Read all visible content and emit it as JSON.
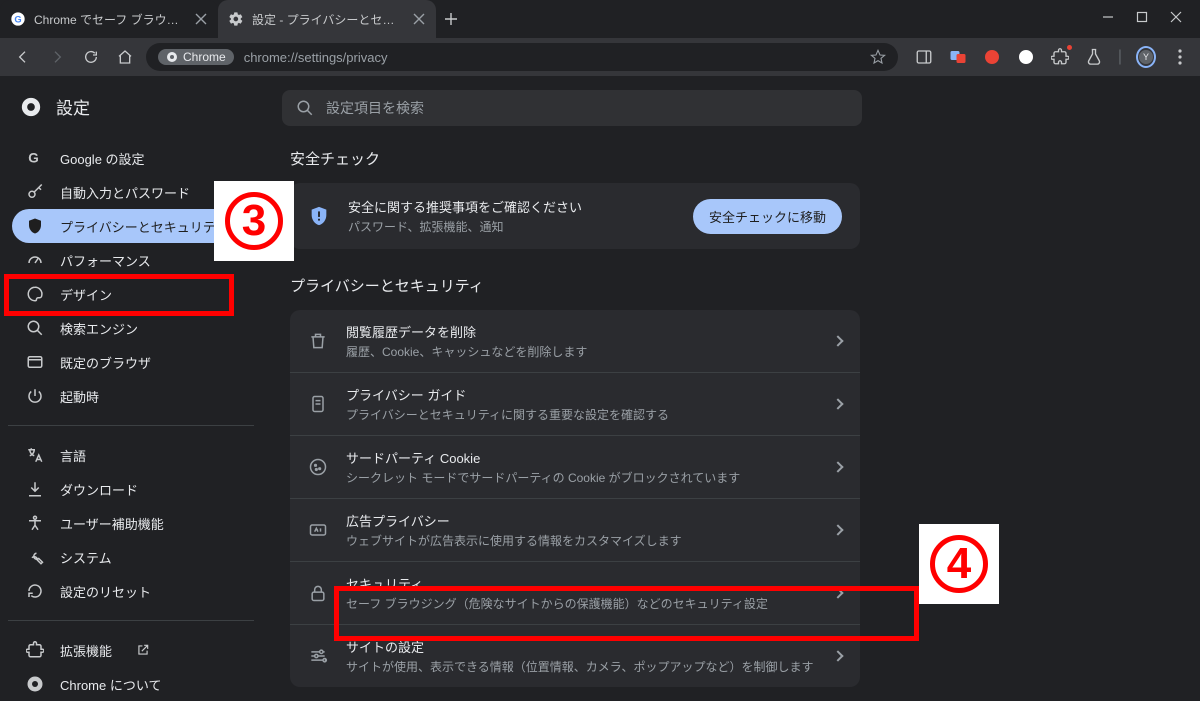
{
  "tabs": [
    {
      "title": "Chrome でセーフ ブラウジングの保…",
      "active": false,
      "favicon": "google-g"
    },
    {
      "title": "設定 - プライバシーとセキュリティ",
      "active": true,
      "favicon": "gear"
    }
  ],
  "omnibox": {
    "scheme_chip": "Chrome",
    "path": "chrome://settings/privacy"
  },
  "avatar_letter": "Y",
  "settings_title": "設定",
  "search_placeholder": "設定項目を検索",
  "sidebar": {
    "groups": [
      [
        {
          "icon": "google-g",
          "label": "Google の設定"
        },
        {
          "icon": "key",
          "label": "自動入力とパスワード"
        },
        {
          "icon": "shield-priv",
          "label": "プライバシーとセキュリティ",
          "selected": true
        },
        {
          "icon": "gauge",
          "label": "パフォーマンス"
        },
        {
          "icon": "palette",
          "label": "デザイン"
        },
        {
          "icon": "search",
          "label": "検索エンジン"
        },
        {
          "icon": "browser",
          "label": "既定のブラウザ"
        },
        {
          "icon": "power",
          "label": "起動時"
        }
      ],
      [
        {
          "icon": "translate",
          "label": "言語"
        },
        {
          "icon": "download",
          "label": "ダウンロード"
        },
        {
          "icon": "accessibility",
          "label": "ユーザー補助機能"
        },
        {
          "icon": "wrench",
          "label": "システム"
        },
        {
          "icon": "reset",
          "label": "設定のリセット"
        }
      ],
      [
        {
          "icon": "puzzle",
          "label": "拡張機能",
          "external": true
        },
        {
          "icon": "chrome",
          "label": "Chrome について"
        }
      ]
    ]
  },
  "sections": {
    "safety_title": "安全チェック",
    "safety_line1": "安全に関する推奨事項をご確認ください",
    "safety_line2": "パスワード、拡張機能、通知",
    "safety_button": "安全チェックに移動",
    "privacy_title": "プライバシーとセキュリティ",
    "privacy_rows": [
      {
        "icon": "trash",
        "title": "閲覧履歴データを削除",
        "sub": "履歴、Cookie、キャッシュなどを削除します"
      },
      {
        "icon": "guide",
        "title": "プライバシー ガイド",
        "sub": "プライバシーとセキュリティに関する重要な設定を確認する"
      },
      {
        "icon": "cookie",
        "title": "サードパーティ Cookie",
        "sub": "シークレット モードでサードパーティの Cookie がブロックされています"
      },
      {
        "icon": "ads",
        "title": "広告プライバシー",
        "sub": "ウェブサイトが広告表示に使用する情報をカスタマイズします"
      },
      {
        "icon": "lock",
        "title": "セキュリティ",
        "sub": "セーフ ブラウジング（危険なサイトからの保護機能）などのセキュリティ設定"
      },
      {
        "icon": "tune",
        "title": "サイトの設定",
        "sub": "サイトが使用、表示できる情報（位置情報、カメラ、ポップアップなど）を制御します"
      }
    ]
  },
  "annotations": {
    "three": "3",
    "four": "4"
  }
}
